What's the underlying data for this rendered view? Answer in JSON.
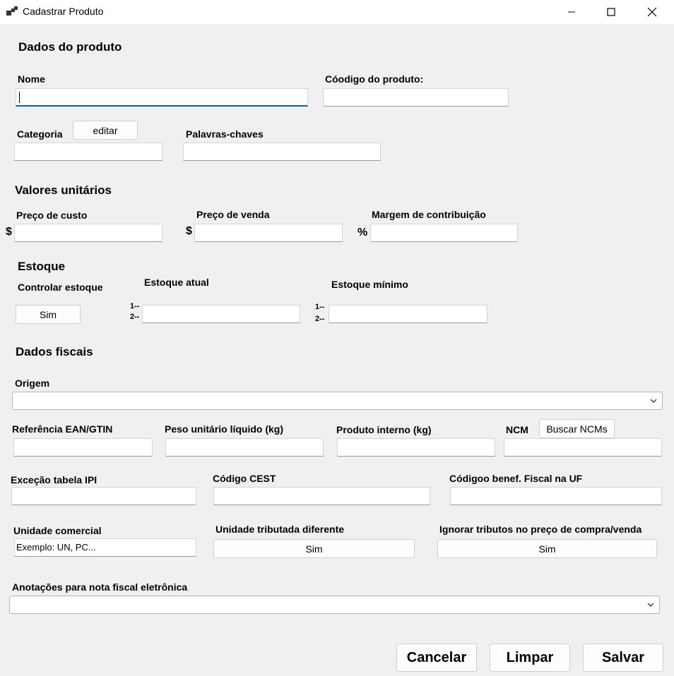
{
  "window": {
    "title": "Cadastrar Produto"
  },
  "sections": {
    "dados_produto": "Dados do produto",
    "valores": "Valores unitários",
    "estoque": "Estoque",
    "fiscais": "Dados fiscais"
  },
  "fields": {
    "nome": "Nome",
    "codigo": "Cóodigo do produto:",
    "categoria": "Categoria",
    "editar_btn": "editar",
    "palavras": "Palavras-chaves",
    "preco_custo": "Preço de custo",
    "preco_venda": "Preço de venda",
    "margem": "Margem de contribuição",
    "controlar_estoque": "Controlar estoque",
    "estoque_atual": "Estoque atual",
    "estoque_minimo": "Estoque mínimo",
    "sim": "Sim",
    "origem": "Origem",
    "ean": "Referência EAN/GTIN",
    "peso": "Peso unitário líquido (kg)",
    "produto_interno": "Produto interno (kg)",
    "ncm": "NCM",
    "buscar_ncm": "Buscar NCMs",
    "excecao_ipi": "Exceção tabela IPI",
    "cest": "Código CEST",
    "benef_fiscal": "Códigoo benef. Fiscal na UF",
    "unidade_comercial": "Unidade comercial",
    "unidade_comercial_value": "Exemplo: UN, PC...",
    "unidade_tributada": "Unidade tributada diferente",
    "ignorar_tributos": "Ignorar tributos no preço de compra/venda",
    "anotacoes": "Anotações para nota fiscal eletrônica"
  },
  "prefixes": {
    "dollar": "$",
    "percent": "%",
    "line1": "1--",
    "line2": "2--"
  },
  "footer": {
    "cancelar": "Cancelar",
    "limpar": "Limpar",
    "salvar": "Salvar"
  }
}
